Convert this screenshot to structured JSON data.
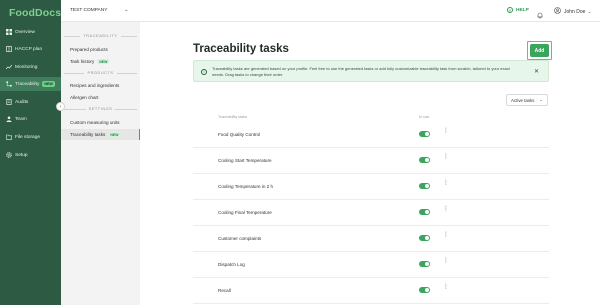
{
  "app": {
    "logo": "FoodDocs"
  },
  "sidebar": {
    "items": [
      {
        "label": "Overview",
        "icon": "grid-icon"
      },
      {
        "label": "HACCP plan",
        "icon": "book-icon"
      },
      {
        "label": "Monitoring",
        "icon": "chart-icon"
      },
      {
        "label": "Traceability",
        "icon": "trace-icon",
        "badge": "NEW",
        "active": true
      },
      {
        "label": "Audits",
        "icon": "audit-icon"
      },
      {
        "label": "Team",
        "icon": "team-icon"
      },
      {
        "label": "File storage",
        "icon": "folder-icon"
      },
      {
        "label": "Setup",
        "icon": "gear-icon"
      }
    ]
  },
  "topbar": {
    "company": "TEST COMPANY",
    "help": "HELP",
    "user": "John Doe"
  },
  "subnav": {
    "sections": [
      {
        "header": "TRACEABILITY"
      },
      {
        "header": "PRODUCTS"
      },
      {
        "header": "SETTINGS"
      }
    ],
    "items": [
      {
        "label": "Prepared products"
      },
      {
        "label": "Task history",
        "badge": "NEW"
      },
      {
        "label": "Recipes and ingredients"
      },
      {
        "label": "Allergen chart"
      },
      {
        "label": "Custom measuring units"
      },
      {
        "label": "Traceability tasks",
        "badge": "NEW",
        "active": true
      }
    ]
  },
  "main": {
    "title": "Traceability tasks",
    "add_label": "Add",
    "info_text": "Traceability tasks are generated based on your profile. Feel free to use the generated tasks or add fully customizable traceability task from scratch, tailored to your exact needs. Drag tasks to change their order.",
    "filter_value": "Active tasks",
    "columns": {
      "name": "Traceability tasks",
      "in_use": "In use"
    },
    "tasks": [
      {
        "name": "Food Quality Control",
        "in_use": true
      },
      {
        "name": "Cooling Start Temperature",
        "in_use": true
      },
      {
        "name": "Cooling Temperature in 2 h",
        "in_use": true
      },
      {
        "name": "Cooling Final Temperature",
        "in_use": true
      },
      {
        "name": "Customer complaints",
        "in_use": true
      },
      {
        "name": "Dispatch Log",
        "in_use": true
      },
      {
        "name": "Recall",
        "in_use": true
      }
    ]
  },
  "colors": {
    "sidebar_bg": "#2d5a43",
    "accent": "#3aa55c",
    "highlight_border": "#f08a24",
    "info_bg": "#e7f6ea"
  }
}
